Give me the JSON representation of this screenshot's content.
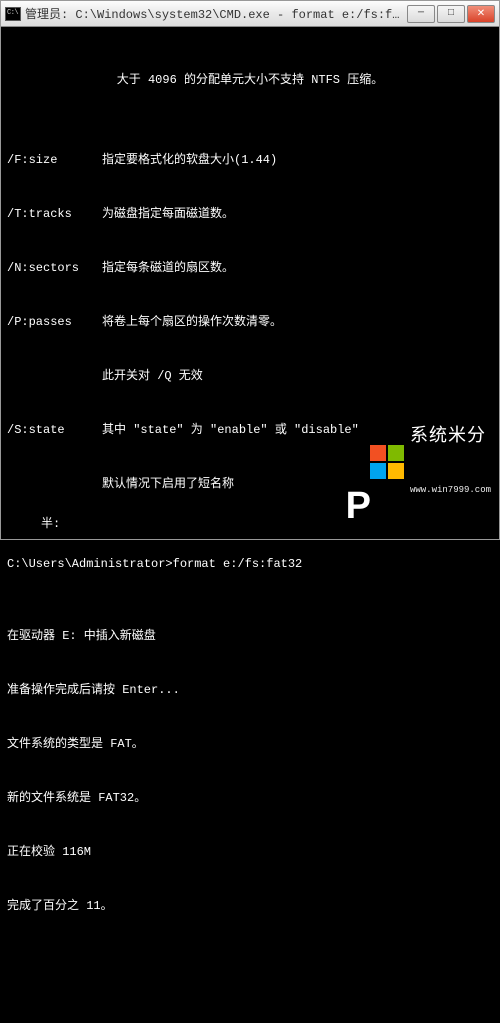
{
  "titlebar": {
    "text": "管理员: C:\\Windows\\system32\\CMD.exe - format  e:/fs:fat32"
  },
  "window_controls": {
    "minimize": "─",
    "maximize": "□",
    "close": "✕"
  },
  "console": {
    "header": "大于 4096 的分配单元大小不支持 NTFS 压缩。",
    "options": [
      {
        "key": "/F:size",
        "desc": "指定要格式化的软盘大小(1.44)"
      },
      {
        "key": "/T:tracks",
        "desc": "为磁盘指定每面磁道数。"
      },
      {
        "key": "/N:sectors",
        "desc": "指定每条磁道的扇区数。"
      },
      {
        "key": "/P:passes",
        "desc": "将卷上每个扇区的操作次数清零。"
      },
      {
        "key": "",
        "desc": "此开关对 /Q 无效"
      },
      {
        "key": "/S:state",
        "desc": "其中 \"state\" 为 \"enable\" 或 \"disable\""
      },
      {
        "key": "",
        "desc": "默认情况下启用了短名称"
      }
    ],
    "prompt": "C:\\Users\\Administrator>format e:/fs:fat32",
    "progress": [
      "在驱动器 E: 中插入新磁盘",
      "准备操作完成后请按 Enter...",
      "文件系统的类型是 FAT。",
      "新的文件系统是 FAT32。",
      "正在校验 116M",
      "完成了百分之 11。"
    ],
    "bottom_input": "半:"
  },
  "watermark": {
    "big_letter": "P",
    "main": "系统米分",
    "sub": "www.win7999.com"
  }
}
